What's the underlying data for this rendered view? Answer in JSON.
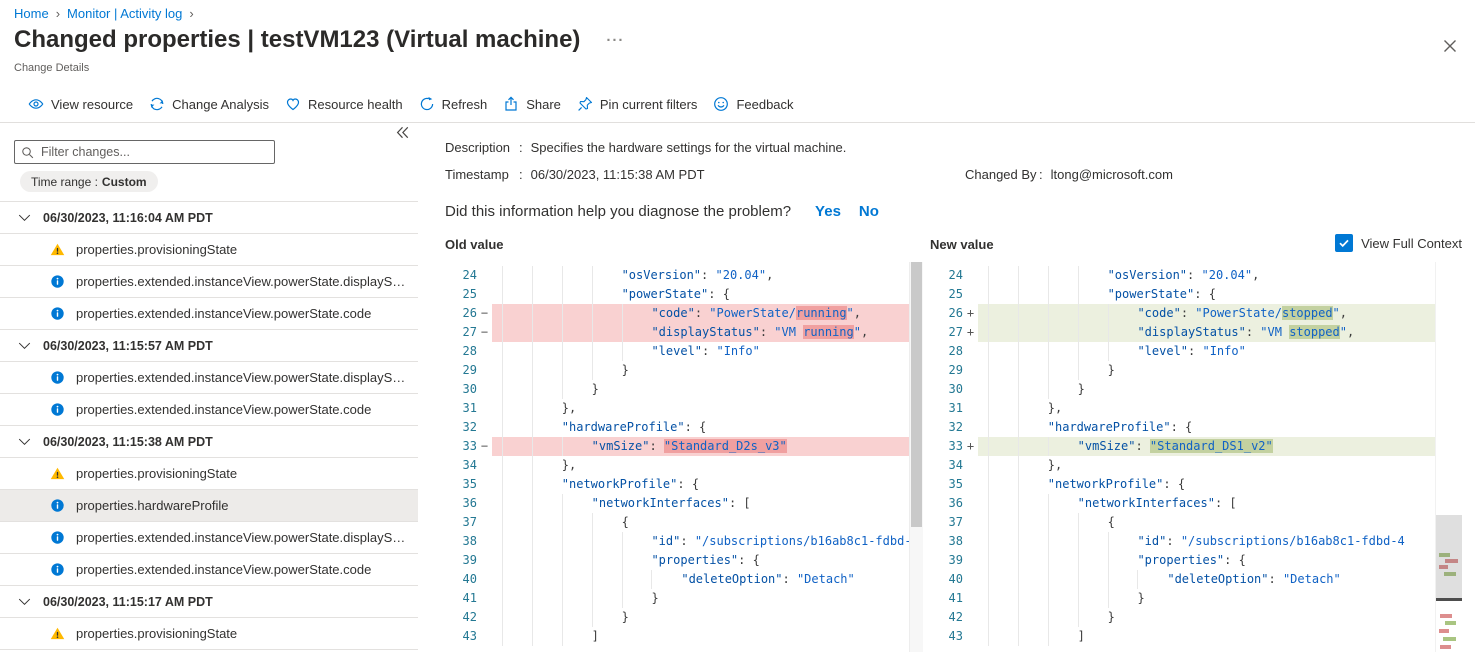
{
  "breadcrumb": {
    "separator": "›",
    "items": [
      {
        "label": "Home"
      },
      {
        "label": "Monitor | Activity log"
      }
    ]
  },
  "header": {
    "title": "Changed properties | testVM123 (Virtual machine)",
    "more_label": "···",
    "subtitle": "Change Details"
  },
  "toolbar": {
    "items": [
      {
        "label": "View resource",
        "icon": "eye-icon"
      },
      {
        "label": "Change Analysis",
        "icon": "change-analysis-icon"
      },
      {
        "label": "Resource health",
        "icon": "heart-icon"
      },
      {
        "label": "Refresh",
        "icon": "refresh-icon"
      },
      {
        "label": "Share",
        "icon": "share-icon"
      },
      {
        "label": "Pin current filters",
        "icon": "pin-icon"
      },
      {
        "label": "Feedback",
        "icon": "feedback-icon"
      }
    ]
  },
  "sidebar": {
    "filter_placeholder": "Filter changes...",
    "time_range_label": "Time range :",
    "time_range_value": "Custom",
    "groups": [
      {
        "timestamp": "06/30/2023, 11:16:04 AM PDT",
        "items": [
          {
            "icon": "warning",
            "label": "properties.provisioningState"
          },
          {
            "icon": "info",
            "label": "properties.extended.instanceView.powerState.displaySta..."
          },
          {
            "icon": "info",
            "label": "properties.extended.instanceView.powerState.code"
          }
        ]
      },
      {
        "timestamp": "06/30/2023, 11:15:57 AM PDT",
        "items": [
          {
            "icon": "info",
            "label": "properties.extended.instanceView.powerState.displaySta..."
          },
          {
            "icon": "info",
            "label": "properties.extended.instanceView.powerState.code"
          }
        ]
      },
      {
        "timestamp": "06/30/2023, 11:15:38 AM PDT",
        "items": [
          {
            "icon": "warning",
            "label": "properties.provisioningState"
          },
          {
            "icon": "info",
            "label": "properties.hardwareProfile",
            "selected": true
          },
          {
            "icon": "info",
            "label": "properties.extended.instanceView.powerState.displaySta..."
          },
          {
            "icon": "info",
            "label": "properties.extended.instanceView.powerState.code"
          }
        ]
      },
      {
        "timestamp": "06/30/2023, 11:15:17 AM PDT",
        "items": [
          {
            "icon": "warning",
            "label": "properties.provisioningState"
          }
        ]
      }
    ]
  },
  "details": {
    "description_label": "Description",
    "timestamp_label": "Timestamp",
    "changed_by_label": "Changed By",
    "separator": ":",
    "description_value": "Specifies the hardware settings for the virtual machine.",
    "timestamp_value": "06/30/2023, 11:15:38 AM PDT",
    "changed_by_value": "ltong@microsoft.com",
    "question": "Did this information help you diagnose the problem?",
    "yes_label": "Yes",
    "no_label": "No"
  },
  "diff": {
    "old_header": "Old value",
    "new_header": "New value",
    "view_full_context_label": "View Full Context",
    "view_full_context_checked": true,
    "removed_sign": "−",
    "added_sign": "+",
    "lines": [
      {
        "num": 24,
        "indent": 16,
        "status": "same",
        "parts": [
          [
            "k",
            "\"osVersion\""
          ],
          [
            "p",
            ": "
          ],
          [
            "s",
            "\"20.04\""
          ],
          [
            "p",
            ","
          ]
        ]
      },
      {
        "num": 25,
        "indent": 16,
        "status": "same",
        "parts": [
          [
            "k",
            "\"powerState\""
          ],
          [
            "p",
            ": {"
          ]
        ]
      },
      {
        "num": 26,
        "indent": 20,
        "status": "changed",
        "old": [
          [
            "k",
            "\"code\""
          ],
          [
            "p",
            ": "
          ],
          [
            "s",
            "\"PowerState/"
          ],
          [
            "h",
            "running"
          ],
          [
            "s",
            "\""
          ],
          [
            "p",
            ","
          ]
        ],
        "new": [
          [
            "k",
            "\"code\""
          ],
          [
            "p",
            ": "
          ],
          [
            "s",
            "\"PowerState/"
          ],
          [
            "h",
            "stopped"
          ],
          [
            "s",
            "\""
          ],
          [
            "p",
            ","
          ]
        ]
      },
      {
        "num": 27,
        "indent": 20,
        "status": "changed",
        "old": [
          [
            "k",
            "\"displayStatus\""
          ],
          [
            "p",
            ": "
          ],
          [
            "s",
            "\"VM "
          ],
          [
            "h",
            "running"
          ],
          [
            "s",
            "\""
          ],
          [
            "p",
            ","
          ]
        ],
        "new": [
          [
            "k",
            "\"displayStatus\""
          ],
          [
            "p",
            ": "
          ],
          [
            "s",
            "\"VM "
          ],
          [
            "h",
            "stopped"
          ],
          [
            "s",
            "\""
          ],
          [
            "p",
            ","
          ]
        ]
      },
      {
        "num": 28,
        "indent": 20,
        "status": "same",
        "parts": [
          [
            "k",
            "\"level\""
          ],
          [
            "p",
            ": "
          ],
          [
            "s",
            "\"Info\""
          ]
        ]
      },
      {
        "num": 29,
        "indent": 16,
        "status": "same",
        "parts": [
          [
            "p",
            "}"
          ]
        ]
      },
      {
        "num": 30,
        "indent": 12,
        "status": "same",
        "parts": [
          [
            "p",
            "}"
          ]
        ]
      },
      {
        "num": 31,
        "indent": 8,
        "status": "same",
        "parts": [
          [
            "p",
            "},"
          ]
        ]
      },
      {
        "num": 32,
        "indent": 8,
        "status": "same",
        "parts": [
          [
            "k",
            "\"hardwareProfile\""
          ],
          [
            "p",
            ": {"
          ]
        ]
      },
      {
        "num": 33,
        "indent": 12,
        "status": "changed",
        "old": [
          [
            "k",
            "\"vmSize\""
          ],
          [
            "p",
            ": "
          ],
          [
            "h",
            "\"Standard_D2s_v3\""
          ]
        ],
        "new": [
          [
            "k",
            "\"vmSize\""
          ],
          [
            "p",
            ": "
          ],
          [
            "h",
            "\"Standard_DS1_v2\""
          ]
        ]
      },
      {
        "num": 34,
        "indent": 8,
        "status": "same",
        "parts": [
          [
            "p",
            "},"
          ]
        ]
      },
      {
        "num": 35,
        "indent": 8,
        "status": "same",
        "parts": [
          [
            "k",
            "\"networkProfile\""
          ],
          [
            "p",
            ": {"
          ]
        ]
      },
      {
        "num": 36,
        "indent": 12,
        "status": "same",
        "parts": [
          [
            "k",
            "\"networkInterfaces\""
          ],
          [
            "p",
            ": ["
          ]
        ]
      },
      {
        "num": 37,
        "indent": 16,
        "status": "same",
        "parts": [
          [
            "p",
            "{"
          ]
        ]
      },
      {
        "num": 38,
        "indent": 20,
        "status": "same",
        "parts": [
          [
            "k",
            "\"id\""
          ],
          [
            "p",
            ": "
          ],
          [
            "s",
            "\"/subscriptions/b16ab8c1-fdbd-4"
          ]
        ]
      },
      {
        "num": 39,
        "indent": 20,
        "status": "same",
        "parts": [
          [
            "k",
            "\"properties\""
          ],
          [
            "p",
            ": {"
          ]
        ]
      },
      {
        "num": 40,
        "indent": 24,
        "status": "same",
        "parts": [
          [
            "k",
            "\"deleteOption\""
          ],
          [
            "p",
            ": "
          ],
          [
            "s",
            "\"Detach\""
          ]
        ]
      },
      {
        "num": 41,
        "indent": 20,
        "status": "same",
        "parts": [
          [
            "p",
            "}"
          ]
        ]
      },
      {
        "num": 42,
        "indent": 16,
        "status": "same",
        "parts": [
          [
            "p",
            "}"
          ]
        ]
      },
      {
        "num": 43,
        "indent": 12,
        "status": "same",
        "parts": [
          [
            "p",
            "]"
          ]
        ]
      }
    ]
  },
  "colors": {
    "accent": "#0078d4",
    "warning": "#ffb900",
    "info": "#0078d4",
    "selection_bg": "#edebe9",
    "line_number": "#237893",
    "code_key": "#0451a5",
    "code_string": "#1062c5",
    "removed_line_bg": "#f9d1d1",
    "removed_word_bg": "#f0a0a0",
    "added_line_bg": "#ecf0df",
    "added_word_bg": "#c3d1a0"
  }
}
